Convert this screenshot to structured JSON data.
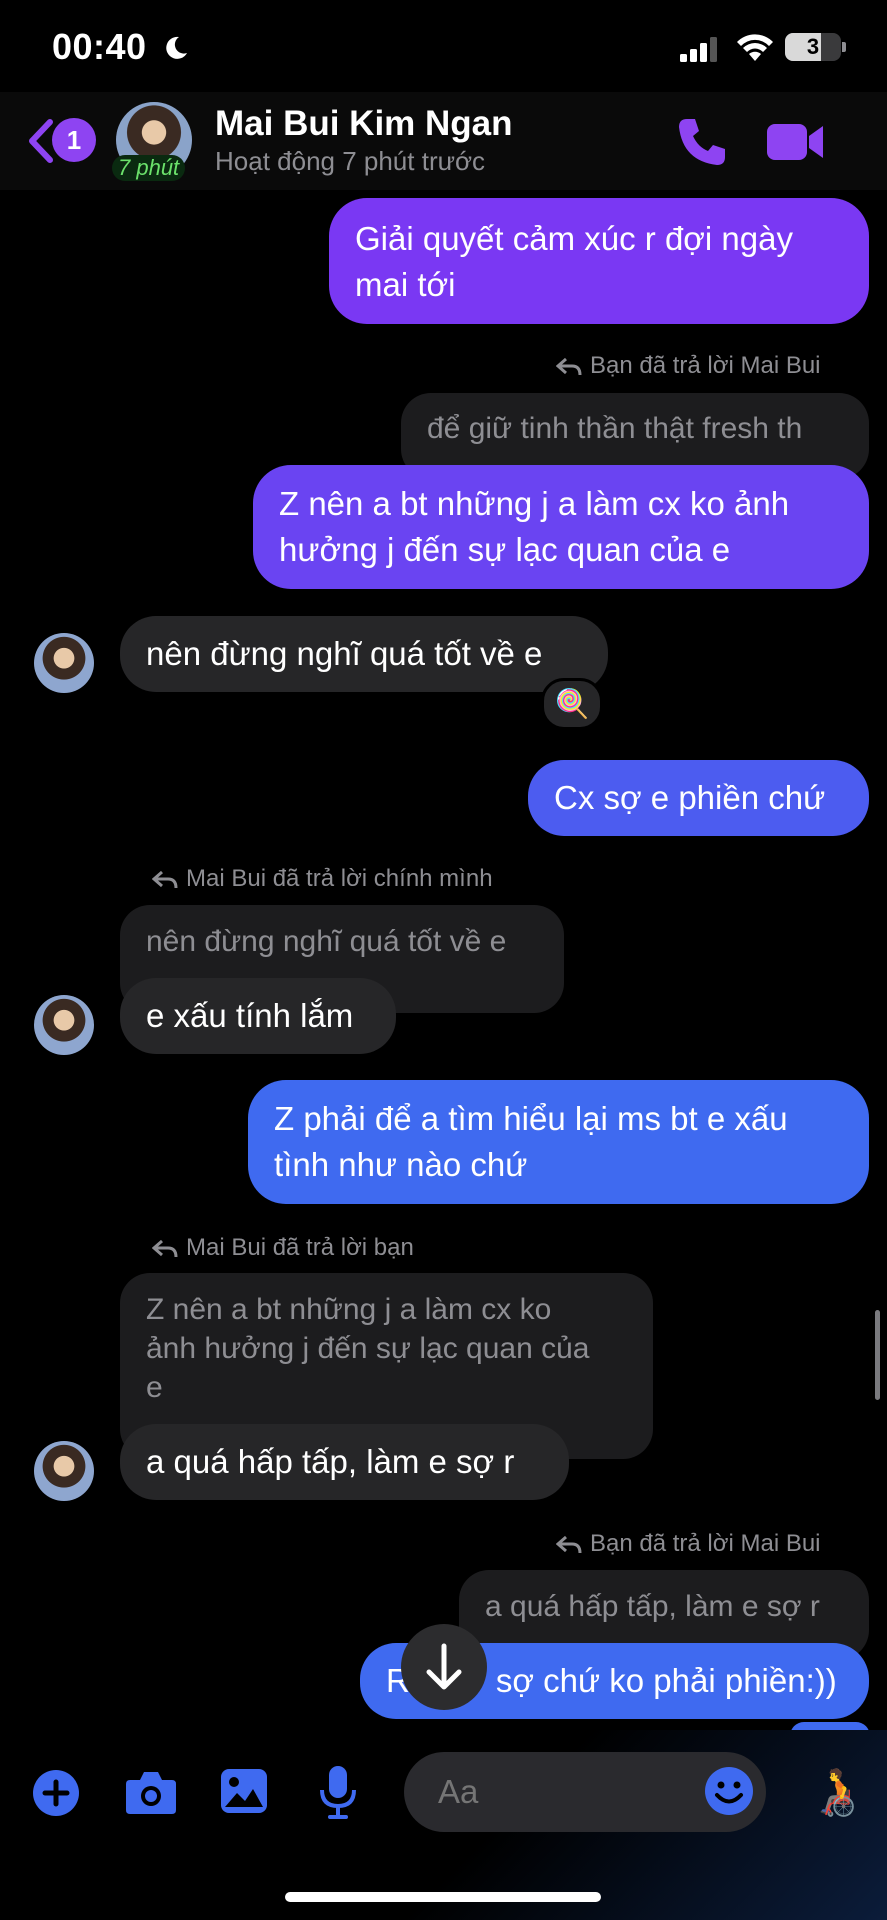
{
  "status_bar": {
    "time": "00:40",
    "battery": "3"
  },
  "header": {
    "back_badge": "1",
    "active_badge": "7 phút",
    "name": "Mai Bui Kim Ngan",
    "status": "Hoạt động 7 phút trước"
  },
  "messages": [
    {
      "type": "out",
      "text_l1": "Giải quyết cảm xúc r đợi ngày",
      "text_l2": "mai tới"
    },
    {
      "type": "reply_meta",
      "text": "Bạn đã trả lời Mai Bui"
    },
    {
      "type": "quoted",
      "text": "để giữ tinh thần thật fresh th"
    },
    {
      "type": "out",
      "text_l1": "Z nên a bt những j a làm cx ko ảnh",
      "text_l2": "hưởng j đến sự lạc quan của e"
    },
    {
      "type": "in",
      "text": "nên đừng nghĩ quá tốt về e",
      "reaction": "🍭"
    },
    {
      "type": "out",
      "text": "Cx sợ e phiền chứ"
    },
    {
      "type": "reply_meta",
      "text": "Mai Bui đã trả lời chính mình"
    },
    {
      "type": "quoted",
      "text": "nên đừng nghĩ quá tốt về e"
    },
    {
      "type": "in",
      "text": "e xấu tính lắm"
    },
    {
      "type": "out",
      "text_l1": "Z phải để a tìm hiểu lại ms bt e xấu",
      "text_l2": "tình như nào chứ"
    },
    {
      "type": "reply_meta",
      "text": "Mai Bui đã trả lời bạn"
    },
    {
      "type": "quoted",
      "text_l1": "Z nên a bt những j a làm cx ko",
      "text_l2": "ảnh hưởng j đến sự lạc quan của",
      "text_l3": "e"
    },
    {
      "type": "in",
      "text": "a quá hấp tấp, làm e sợ r"
    },
    {
      "type": "reply_meta",
      "text": "Bạn đã trả lời Mai Bui"
    },
    {
      "type": "quoted",
      "text": "a quá hấp tấp, làm e sợ r"
    },
    {
      "type": "out",
      "text_a": "R",
      "text_b": "sợ chứ ko phải phiền:))"
    }
  ],
  "composer": {
    "placeholder": "Aa"
  },
  "colors": {
    "accent": "#8e44f2",
    "bubble_purple": "#7a38f3",
    "bubble_blue": "#4c5cf0",
    "bubble_incoming": "#262628"
  },
  "icons": [
    "back-chevron-icon",
    "phone-icon",
    "video-camera-icon",
    "reply-arrow-icon",
    "plus-icon",
    "camera-icon",
    "image-icon",
    "microphone-icon",
    "emoji-icon",
    "arrow-down-icon"
  ]
}
